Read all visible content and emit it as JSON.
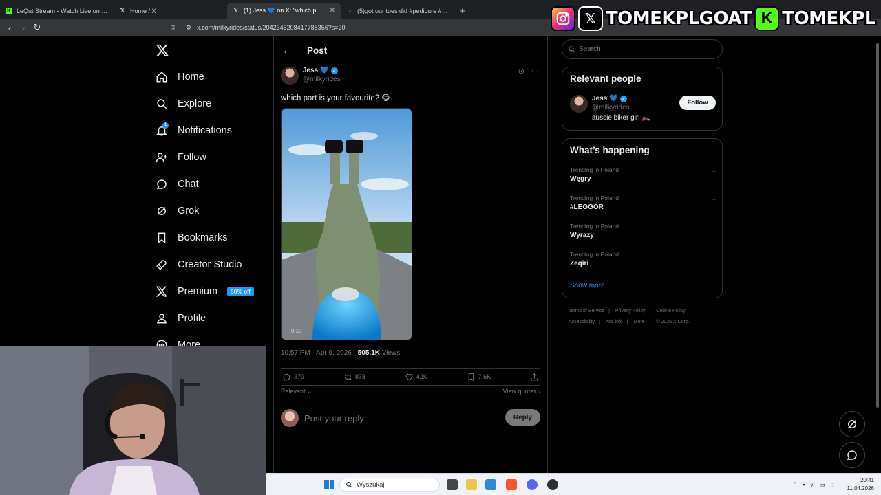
{
  "browser": {
    "tabs": [
      {
        "title": "LeQut Stream - Watch Live on Kick",
        "active": false,
        "favicon": "kick-icon"
      },
      {
        "title": "Home / X",
        "active": false,
        "favicon": "x-icon"
      },
      {
        "title": "(1) Jess 💙 on X: \"which part is y",
        "active": true,
        "favicon": "x-icon"
      },
      {
        "title": "(5)got our toes did #pedicure #toes",
        "active": false,
        "favicon": "tiktok-icon"
      }
    ],
    "url": "x.com/milkyrides/status/2042346208417788356?s=20"
  },
  "overlay": {
    "name1": "TOMEKPLGOAT",
    "name2": "TOMEKPL"
  },
  "nav": {
    "items": [
      {
        "label": "Home",
        "icon": "home-icon"
      },
      {
        "label": "Explore",
        "icon": "search-icon"
      },
      {
        "label": "Notifications",
        "icon": "bell-icon"
      },
      {
        "label": "Follow",
        "icon": "add-user-icon"
      },
      {
        "label": "Chat",
        "icon": "chat-icon"
      },
      {
        "label": "Grok",
        "icon": "grok-icon"
      },
      {
        "label": "Bookmarks",
        "icon": "bookmark-icon"
      },
      {
        "label": "Creator Studio",
        "icon": "rocket-icon"
      },
      {
        "label": "Premium",
        "icon": "x-logo-icon"
      },
      {
        "label": "Profile",
        "icon": "profile-icon"
      },
      {
        "label": "More",
        "icon": "more-icon"
      }
    ],
    "notification_count": "1",
    "premium_badge": "50% off"
  },
  "post": {
    "header": "Post",
    "display_name": "Jess",
    "heart": "💙",
    "handle": "@milkyrides",
    "text": "which part is your favourite? 😋",
    "timestamp": "10:57 PM · Apr 9, 2026 · ",
    "views_count": "505.1K",
    "views_label": " Views",
    "replies": "379",
    "reposts": "878",
    "likes": "42K",
    "bookmarks": "7.6K",
    "sort": "Relevant",
    "view_quotes": "View quotes",
    "reply_placeholder": "Post your reply",
    "reply_button": "Reply"
  },
  "sidebar": {
    "search_placeholder": "Search",
    "relevant_title": "Relevant people",
    "person": {
      "name": "Jess",
      "heart": "💙",
      "handle": "@milkyrides",
      "bio": "aussie biker girl 🏍️",
      "follow_label": "Follow"
    },
    "happening_title": "What’s happening",
    "trends": [
      {
        "context": "Trending in Poland",
        "name": "Węgry"
      },
      {
        "context": "Trending in Poland",
        "name": "#LEGGÓR"
      },
      {
        "context": "Trending in Poland",
        "name": "Wyrazy"
      },
      {
        "context": "Trending in Poland",
        "name": "Zeqiri"
      }
    ],
    "show_more": "Show more",
    "footer": [
      "Terms of Service",
      "|",
      "Privacy Policy",
      "|",
      "Cookie Policy",
      "|",
      "Accessibility",
      "|",
      "Ads info",
      "|",
      "More ···",
      "© 2026 X Corp."
    ]
  },
  "taskbar": {
    "search_placeholder": "Wyszukaj",
    "time": "20:41",
    "date": "11.04.2026"
  },
  "colors": {
    "accent": "#1d9bf0",
    "background": "#000000",
    "border": "#2f3336",
    "muted": "#71767b",
    "kick_green": "#53fc18"
  }
}
